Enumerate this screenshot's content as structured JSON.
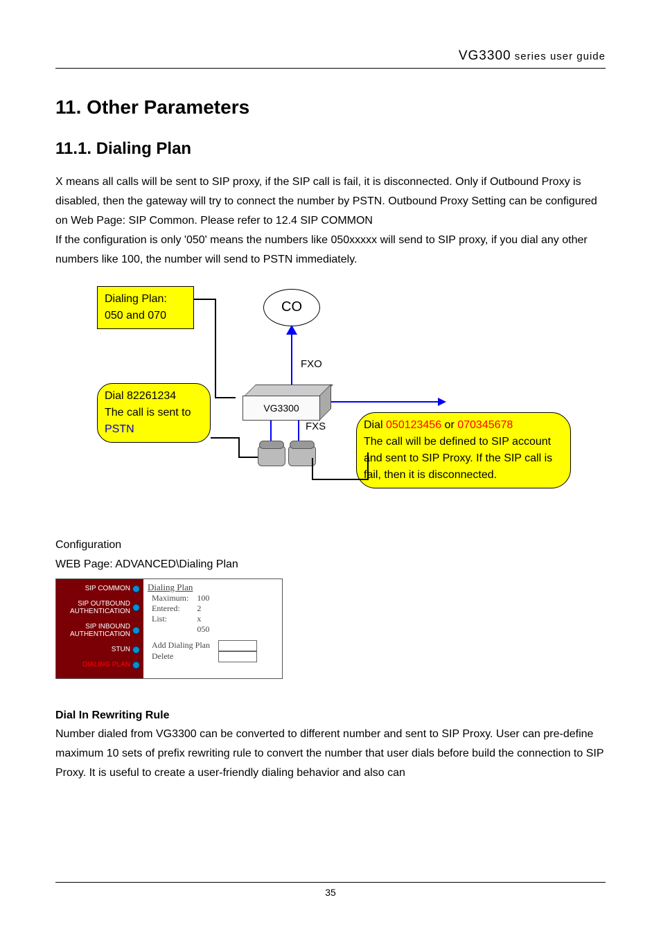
{
  "header": {
    "brand": "VG3300",
    "suffix": " series user guide"
  },
  "chapter": "11.  Other Parameters",
  "section": "11.1.  Dialing Plan",
  "paragraphs": {
    "p1": "X means all calls will be sent to SIP proxy, if the SIP call is fail, it is disconnected. Only if Outbound Proxy is disabled, then the gateway will try to connect the number by PSTN. Outbound Proxy Setting can be configured on Web Page: SIP Common. Please refer to 12.4 SIP COMMON",
    "p2": "If the configuration is only '050' means the numbers like 050xxxxx will send to SIP proxy, if you dial any other numbers like 100, the number will send to PSTN immediately."
  },
  "diagram": {
    "box1_line1": "Dialing Plan:",
    "box1_line2": "050 and 070",
    "co_label": "CO",
    "fxo_label": "FXO",
    "device_label": "VG3300",
    "fxs_label": "FXS",
    "box2_line1": "Dial 82261234",
    "box2_line2": "The call is sent to",
    "box2_line3_pre": "",
    "box2_line3_blue": "PSTN",
    "box3_dial": "Dial ",
    "box3_n1": "050123456",
    "box3_or": " or ",
    "box3_n2": "070345678",
    "box3_line2": "The call will be defined to SIP account",
    "box3_line3": "and sent to SIP Proxy. If the SIP call is",
    "box3_line4": "fail, then it is disconnected."
  },
  "config": {
    "cfg_label": "Configuration",
    "web_page": "WEB Page: ADVANCED\\Dialing Plan"
  },
  "screenshot": {
    "nav": [
      "SIP COMMON",
      "SIP OUTBOUND AUTHENTICATION",
      "SIP INBOUND AUTHENTICATION",
      "STUN",
      "DIALING PLAN"
    ],
    "panel_title": "Dialing Plan",
    "rows": {
      "maximum_label": "Maximum:",
      "maximum_value": "100",
      "entered_label": "Entered:",
      "entered_value": "2",
      "list_label": "List:",
      "list_value1": "x",
      "list_value2": "050",
      "add_label": "Add Dialing Plan",
      "delete_label": "Delete"
    }
  },
  "subhead": "Dial In Rewriting Rule",
  "paragraph_rewrite": "Number dialed from VG3300 can be converted to different number and sent to SIP Proxy. User can pre-define maximum 10 sets of prefix rewriting rule to convert the number that user dials before build the connection to SIP Proxy. It is useful to create a user-friendly dialing behavior and also can",
  "page_number": "35"
}
